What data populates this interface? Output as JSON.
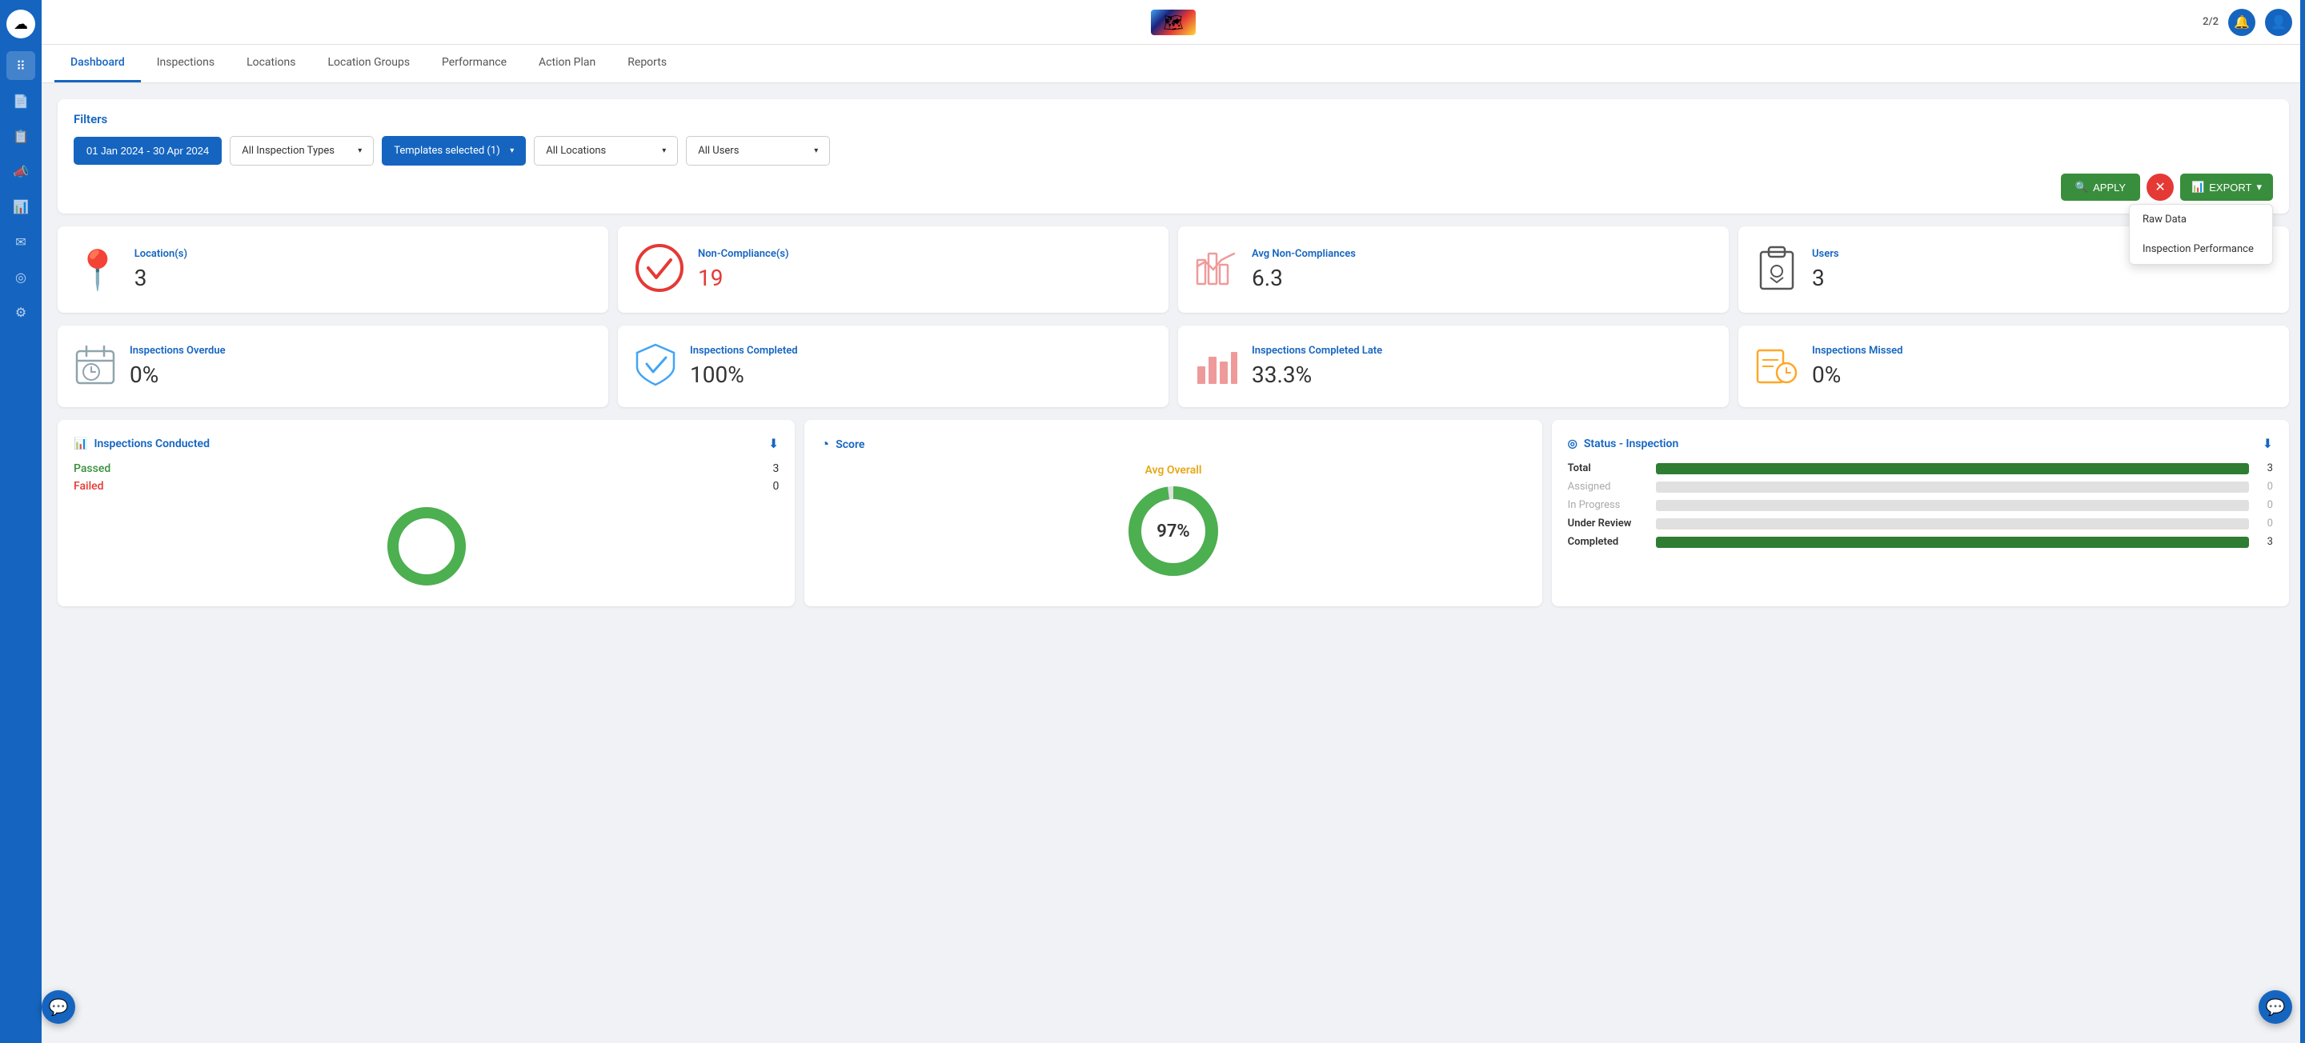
{
  "sidebar": {
    "icons": [
      {
        "name": "dots-grid-icon",
        "symbol": "⠿",
        "active": true
      },
      {
        "name": "document-icon",
        "symbol": "📄",
        "active": false
      },
      {
        "name": "document2-icon",
        "symbol": "📋",
        "active": false
      },
      {
        "name": "megaphone-icon",
        "symbol": "📣",
        "active": false
      },
      {
        "name": "chart-icon",
        "symbol": "📊",
        "active": false
      },
      {
        "name": "mail-icon",
        "symbol": "✉",
        "active": false
      },
      {
        "name": "target-icon",
        "symbol": "◎",
        "active": false
      },
      {
        "name": "settings-icon",
        "symbol": "⚙",
        "active": false
      }
    ]
  },
  "topbar": {
    "count": "2/2",
    "logo_emoji": "🗺"
  },
  "nav": {
    "tabs": [
      {
        "label": "Dashboard",
        "active": true
      },
      {
        "label": "Inspections",
        "active": false
      },
      {
        "label": "Locations",
        "active": false
      },
      {
        "label": "Location Groups",
        "active": false
      },
      {
        "label": "Performance",
        "active": false
      },
      {
        "label": "Action Plan",
        "active": false
      },
      {
        "label": "Reports",
        "active": false
      }
    ]
  },
  "filters": {
    "title": "Filters",
    "date_range": "01 Jan 2024 - 30 Apr 2024",
    "inspection_types": "All Inspection Types",
    "templates": "Templates selected (1)",
    "locations": "All Locations",
    "users": "All Users",
    "apply_label": "APPLY",
    "export_label": "EXPORT",
    "export_options": [
      {
        "label": "Raw Data"
      },
      {
        "label": "Inspection Performance"
      }
    ]
  },
  "stats_row1": [
    {
      "label": "Location(s)",
      "value": "3",
      "icon": "📍",
      "icon_color": "#e57373",
      "value_color": "#333"
    },
    {
      "label": "Non-Compliance(s)",
      "value": "19",
      "icon": "✔",
      "icon_color": "#e53935",
      "value_color": "#e53935",
      "circle": true
    },
    {
      "label": "Avg Non-Compliances",
      "value": "6.3",
      "icon": "📊",
      "icon_color": "#ef9a9a",
      "value_color": "#333"
    },
    {
      "label": "Users",
      "value": "3",
      "icon": "📋",
      "icon_color": "#555",
      "value_color": "#333"
    }
  ],
  "stats_row2": [
    {
      "label": "Inspections Overdue",
      "value": "0%",
      "icon": "📅",
      "icon_color": "#90a4ae"
    },
    {
      "label": "Inspections Completed",
      "value": "100%",
      "icon": "🛡",
      "icon_color": "#42a5f5"
    },
    {
      "label": "Inspections Completed Late",
      "value": "33.3%",
      "icon": "📊",
      "icon_color": "#ef9a9a"
    },
    {
      "label": "Inspections Missed",
      "value": "0%",
      "icon": "🕐",
      "icon_color": "#ffa726"
    }
  ],
  "charts": {
    "conducted": {
      "title": "Inspections Conducted",
      "icon": "📊",
      "passed_label": "Passed",
      "passed_value": 3,
      "failed_label": "Failed",
      "failed_value": 0,
      "donut_pct": 100
    },
    "score": {
      "title": "Score",
      "icon": "◔",
      "avg_label": "Avg Overall",
      "avg_pct": 97,
      "donut_value": "97%"
    },
    "status": {
      "title": "Status - Inspection",
      "icon": "◎",
      "rows": [
        {
          "label": "Total",
          "value": 3,
          "max": 3,
          "color": "#2e7d32",
          "pct": 100
        },
        {
          "label": "Assigned",
          "value": 0,
          "max": 3,
          "color": "#e0e0e0",
          "pct": 0
        },
        {
          "label": "In Progress",
          "value": 0,
          "max": 3,
          "color": "#e0e0e0",
          "pct": 0
        },
        {
          "label": "Under Review",
          "value": 0,
          "max": 3,
          "color": "#e0e0e0",
          "pct": 0
        },
        {
          "label": "Completed",
          "value": 3,
          "max": 3,
          "color": "#2e7d32",
          "pct": 100
        }
      ]
    }
  }
}
